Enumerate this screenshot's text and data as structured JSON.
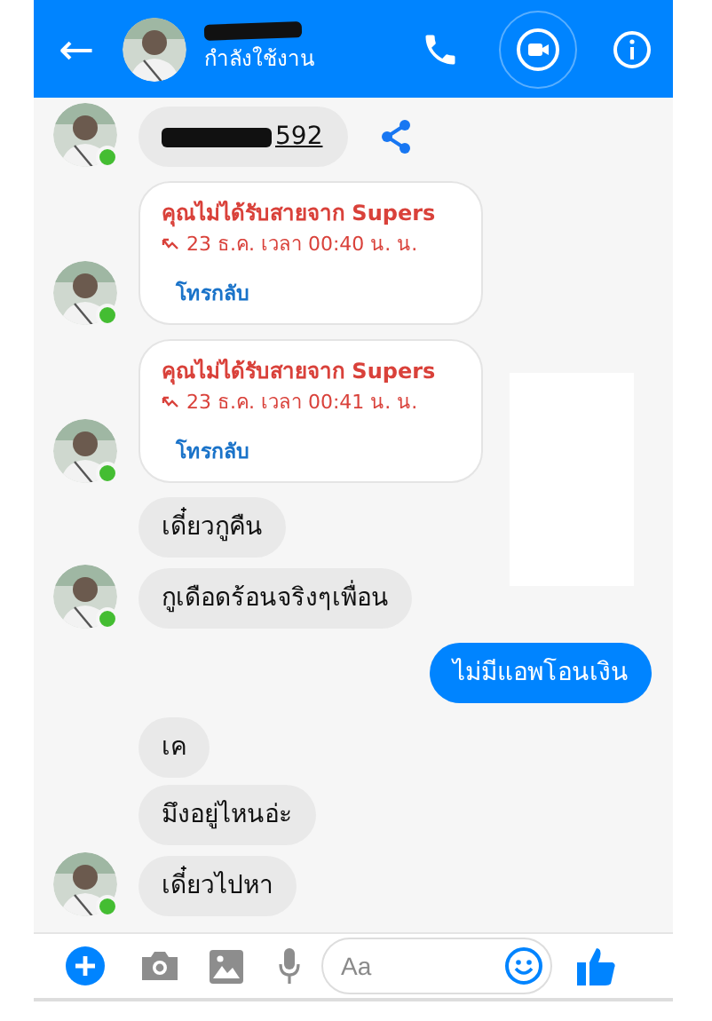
{
  "header": {
    "back_icon": "←",
    "status": "กำลังใช้งาน"
  },
  "messages": [
    {
      "kind": "link",
      "outgoing": false,
      "show_avatar": true,
      "text": "592"
    },
    {
      "kind": "missed_call",
      "outgoing": false,
      "show_avatar": true,
      "title": "คุณไม่ได้รับสายจาก Supers",
      "time": "23 ธ.ค. เวลา 00:40 น. น.",
      "action": "โทรกลับ"
    },
    {
      "kind": "missed_call",
      "outgoing": false,
      "show_avatar": true,
      "title": "คุณไม่ได้รับสายจาก Supers",
      "time": "23 ธ.ค. เวลา 00:41 น. น.",
      "action": "โทรกลับ"
    },
    {
      "kind": "text",
      "outgoing": false,
      "show_avatar": false,
      "text": "เดี๋ยวกูคืน"
    },
    {
      "kind": "text",
      "outgoing": false,
      "show_avatar": true,
      "text": "กูเดือดร้อนจริงๆเพื่อน"
    },
    {
      "kind": "text",
      "outgoing": true,
      "show_avatar": false,
      "text": "ไม่มีแอพโอนเงิน"
    },
    {
      "kind": "text",
      "outgoing": false,
      "show_avatar": false,
      "text": "เค"
    },
    {
      "kind": "text",
      "outgoing": false,
      "show_avatar": false,
      "text": "มึงอยู่ไหนอ่ะ"
    },
    {
      "kind": "text",
      "outgoing": false,
      "show_avatar": true,
      "text": "เดี๋ยวไปหา"
    }
  ],
  "composer": {
    "placeholder": "Aa"
  }
}
